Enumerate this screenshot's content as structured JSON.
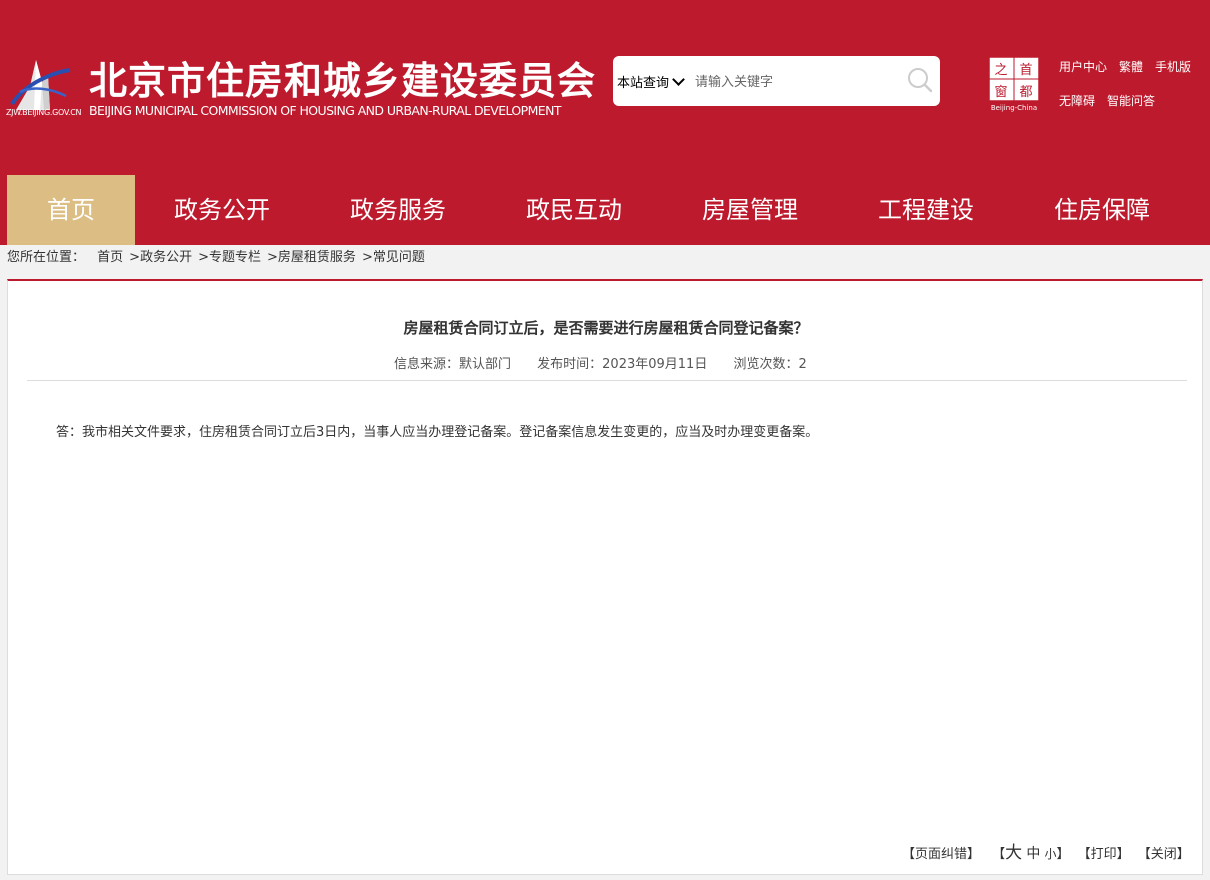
{
  "header": {
    "title": "北京市住房和城乡建设委员会",
    "subtitle": "BEIJING MUNICIPAL COMMISSION OF HOUSING AND URBAN-RURAL DEVELOPMENT",
    "logo_url_text": "ZJW.BEIJING.GOV.CN",
    "brand_color": "#bd1a2d",
    "accent_color": "#dcbe85"
  },
  "search": {
    "scope": "本站查询",
    "placeholder": "请输入关键字"
  },
  "capital_window": {
    "chars": [
      "首",
      "都",
      "之",
      "窗"
    ],
    "caption": "Beijing-China"
  },
  "top_links": [
    "用户中心",
    "繁體",
    "手机版",
    "无障碍",
    "智能问答"
  ],
  "nav": {
    "items": [
      "首页",
      "政务公开",
      "政务服务",
      "政民互动",
      "房屋管理",
      "工程建设",
      "住房保障"
    ],
    "active": "首页"
  },
  "breadcrumb": {
    "label": "您所在位置：",
    "items": [
      "首页",
      "政务公开",
      "专题专栏",
      "房屋租赁服务",
      "常见问题"
    ],
    "separator": ">"
  },
  "article": {
    "title": "房屋租赁合同订立后，是否需要进行房屋租赁合同登记备案？",
    "source": "信息来源：默认部门",
    "date": "发布时间：2023年09月11日",
    "views": "浏览次数：2",
    "body": "答：我市相关文件要求，住房租赁合同订立后3日内，当事人应当办理登记备案。登记备案信息发生变更的，应当及时办理变更备案。"
  },
  "tools": {
    "correction": "【页面纠错】",
    "font_open": "【",
    "font_big": "大",
    "font_mid": "中",
    "font_small": "小",
    "font_close": "】",
    "print": "【打印】",
    "close": "【关闭】"
  },
  "icons": {
    "search": "search-icon",
    "logo": "building-logo-icon",
    "capital": "capital-window-icon"
  }
}
